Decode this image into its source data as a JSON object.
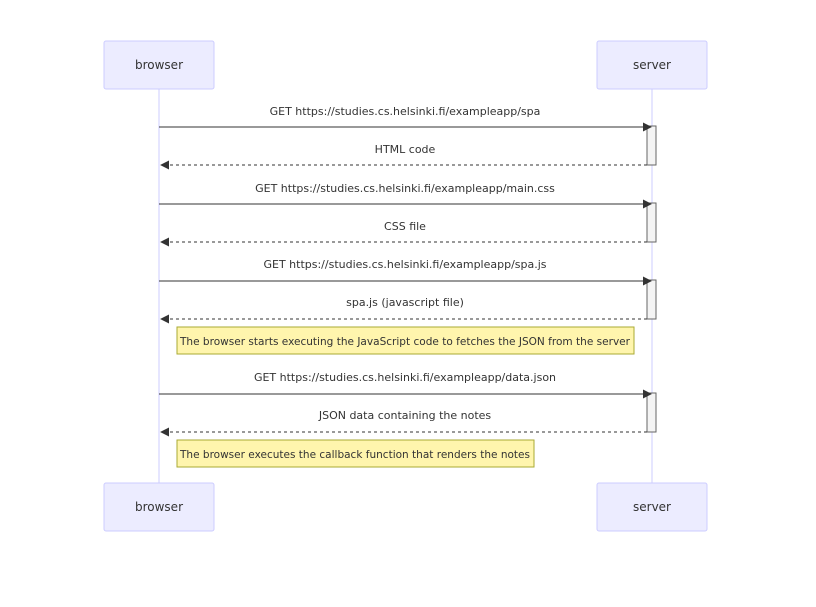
{
  "participants": [
    {
      "id": "browser",
      "label": "browser"
    },
    {
      "id": "server",
      "label": "server"
    }
  ],
  "messages": [
    {
      "from": "browser",
      "to": "server",
      "label": "GET https://studies.cs.helsinki.fi/exampleapp/spa",
      "style": "solid"
    },
    {
      "from": "server",
      "to": "browser",
      "label": "HTML code",
      "style": "dashed"
    },
    {
      "from": "browser",
      "to": "server",
      "label": "GET https://studies.cs.helsinki.fi/exampleapp/main.css",
      "style": "solid"
    },
    {
      "from": "server",
      "to": "browser",
      "label": "CSS file",
      "style": "dashed"
    },
    {
      "from": "browser",
      "to": "server",
      "label": "GET https://studies.cs.helsinki.fi/exampleapp/spa.js",
      "style": "solid"
    },
    {
      "from": "server",
      "to": "browser",
      "label": "spa.js (javascript file)",
      "style": "dashed"
    },
    {
      "from": "browser",
      "to": "server",
      "label": "GET https://studies.cs.helsinki.fi/exampleapp/data.json",
      "style": "solid"
    },
    {
      "from": "server",
      "to": "browser",
      "label": "JSON data containing the notes",
      "style": "dashed"
    }
  ],
  "notes": [
    {
      "over": "browser",
      "text": "The browser starts executing the JavaScript code to fetches the JSON from the server"
    },
    {
      "over": "browser",
      "text": "The browser executes the callback function that renders the notes"
    }
  ],
  "colors": {
    "actor_fill": "#ececff",
    "actor_stroke": "#ccccff",
    "arrow": "#333333",
    "note_fill": "#fff5ad",
    "note_stroke": "#aaaa33"
  }
}
